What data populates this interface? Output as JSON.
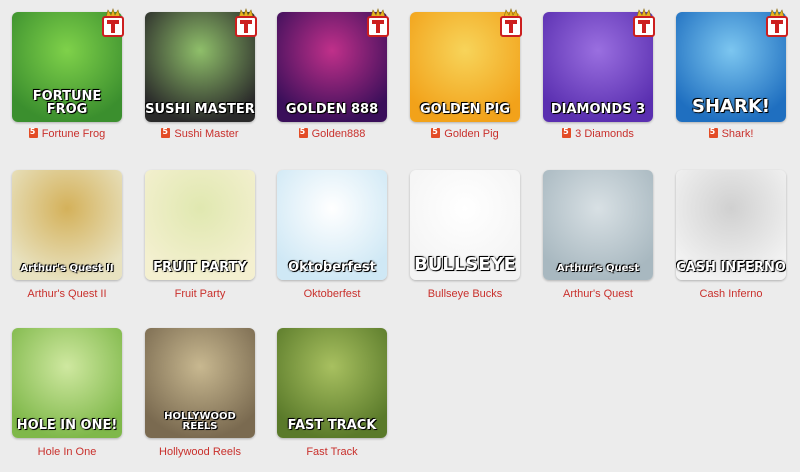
{
  "games": [
    {
      "title": "Fortune Frog",
      "logo": "FORTUNE FROG",
      "html5": true,
      "badge": true,
      "bg": [
        "#3b8f2e",
        "#7fd14a"
      ]
    },
    {
      "title": "Sushi Master",
      "logo": "SUSHI MASTER",
      "html5": true,
      "badge": true,
      "bg": [
        "#2a2a2a",
        "#8fbf6a"
      ]
    },
    {
      "title": "Golden888",
      "logo": "GOLDEN 888",
      "html5": true,
      "badge": true,
      "bg": [
        "#3a0f5a",
        "#c0308a"
      ]
    },
    {
      "title": "Golden Pig",
      "logo": "GOLDEN PIG",
      "html5": true,
      "badge": true,
      "bg": [
        "#f2a21a",
        "#f7d45a"
      ]
    },
    {
      "title": "3 Diamonds",
      "logo": "DIAMONDS 3",
      "html5": true,
      "badge": true,
      "bg": [
        "#5a2fb0",
        "#9a6fe0"
      ]
    },
    {
      "title": "Shark!",
      "logo": "SHARK!",
      "html5": true,
      "badge": true,
      "bg": [
        "#1f6fc0",
        "#7cc6f0"
      ]
    },
    {
      "title": "Arthur's Quest II",
      "logo": "Arthur's Quest II",
      "html5": false,
      "badge": false,
      "bg": [
        "#e8e2c0",
        "#d4b15a"
      ]
    },
    {
      "title": "Fruit Party",
      "logo": "FRUIT PARTY",
      "html5": false,
      "badge": false,
      "bg": [
        "#f4f0d0",
        "#e0e8b0"
      ]
    },
    {
      "title": "Oktoberfest",
      "logo": "Oktoberfest",
      "html5": false,
      "badge": false,
      "bg": [
        "#cfe8f5",
        "#ffffff"
      ]
    },
    {
      "title": "Bullseye Bucks",
      "logo": "BULLSEYE",
      "html5": false,
      "badge": false,
      "bg": [
        "#f4f4f4",
        "#ffffff"
      ]
    },
    {
      "title": "Arthur's Quest",
      "logo": "Arthur's Quest",
      "html5": false,
      "badge": false,
      "bg": [
        "#a8b8c0",
        "#d8e0e4"
      ]
    },
    {
      "title": "Cash Inferno",
      "logo": "CASH INFERNO",
      "html5": false,
      "badge": false,
      "bg": [
        "#f2f2f2",
        "#d0d0d0"
      ]
    },
    {
      "title": "Hole In One",
      "logo": "HOLE IN ONE!",
      "html5": false,
      "badge": false,
      "bg": [
        "#7fb84a",
        "#cfe8a0"
      ]
    },
    {
      "title": "Hollywood Reels",
      "logo": "HOLLYWOOD REELS",
      "html5": false,
      "badge": false,
      "bg": [
        "#7a6a50",
        "#c8b890"
      ]
    },
    {
      "title": "Fast Track",
      "logo": "FAST TRACK",
      "html5": false,
      "badge": false,
      "bg": [
        "#5a7a2a",
        "#a8c060"
      ]
    }
  ],
  "colors": {
    "caption": "#c9302c",
    "html5_icon": "#e34c26",
    "badge_red": "#cc1f1f",
    "badge_gold": "#e6b422"
  }
}
